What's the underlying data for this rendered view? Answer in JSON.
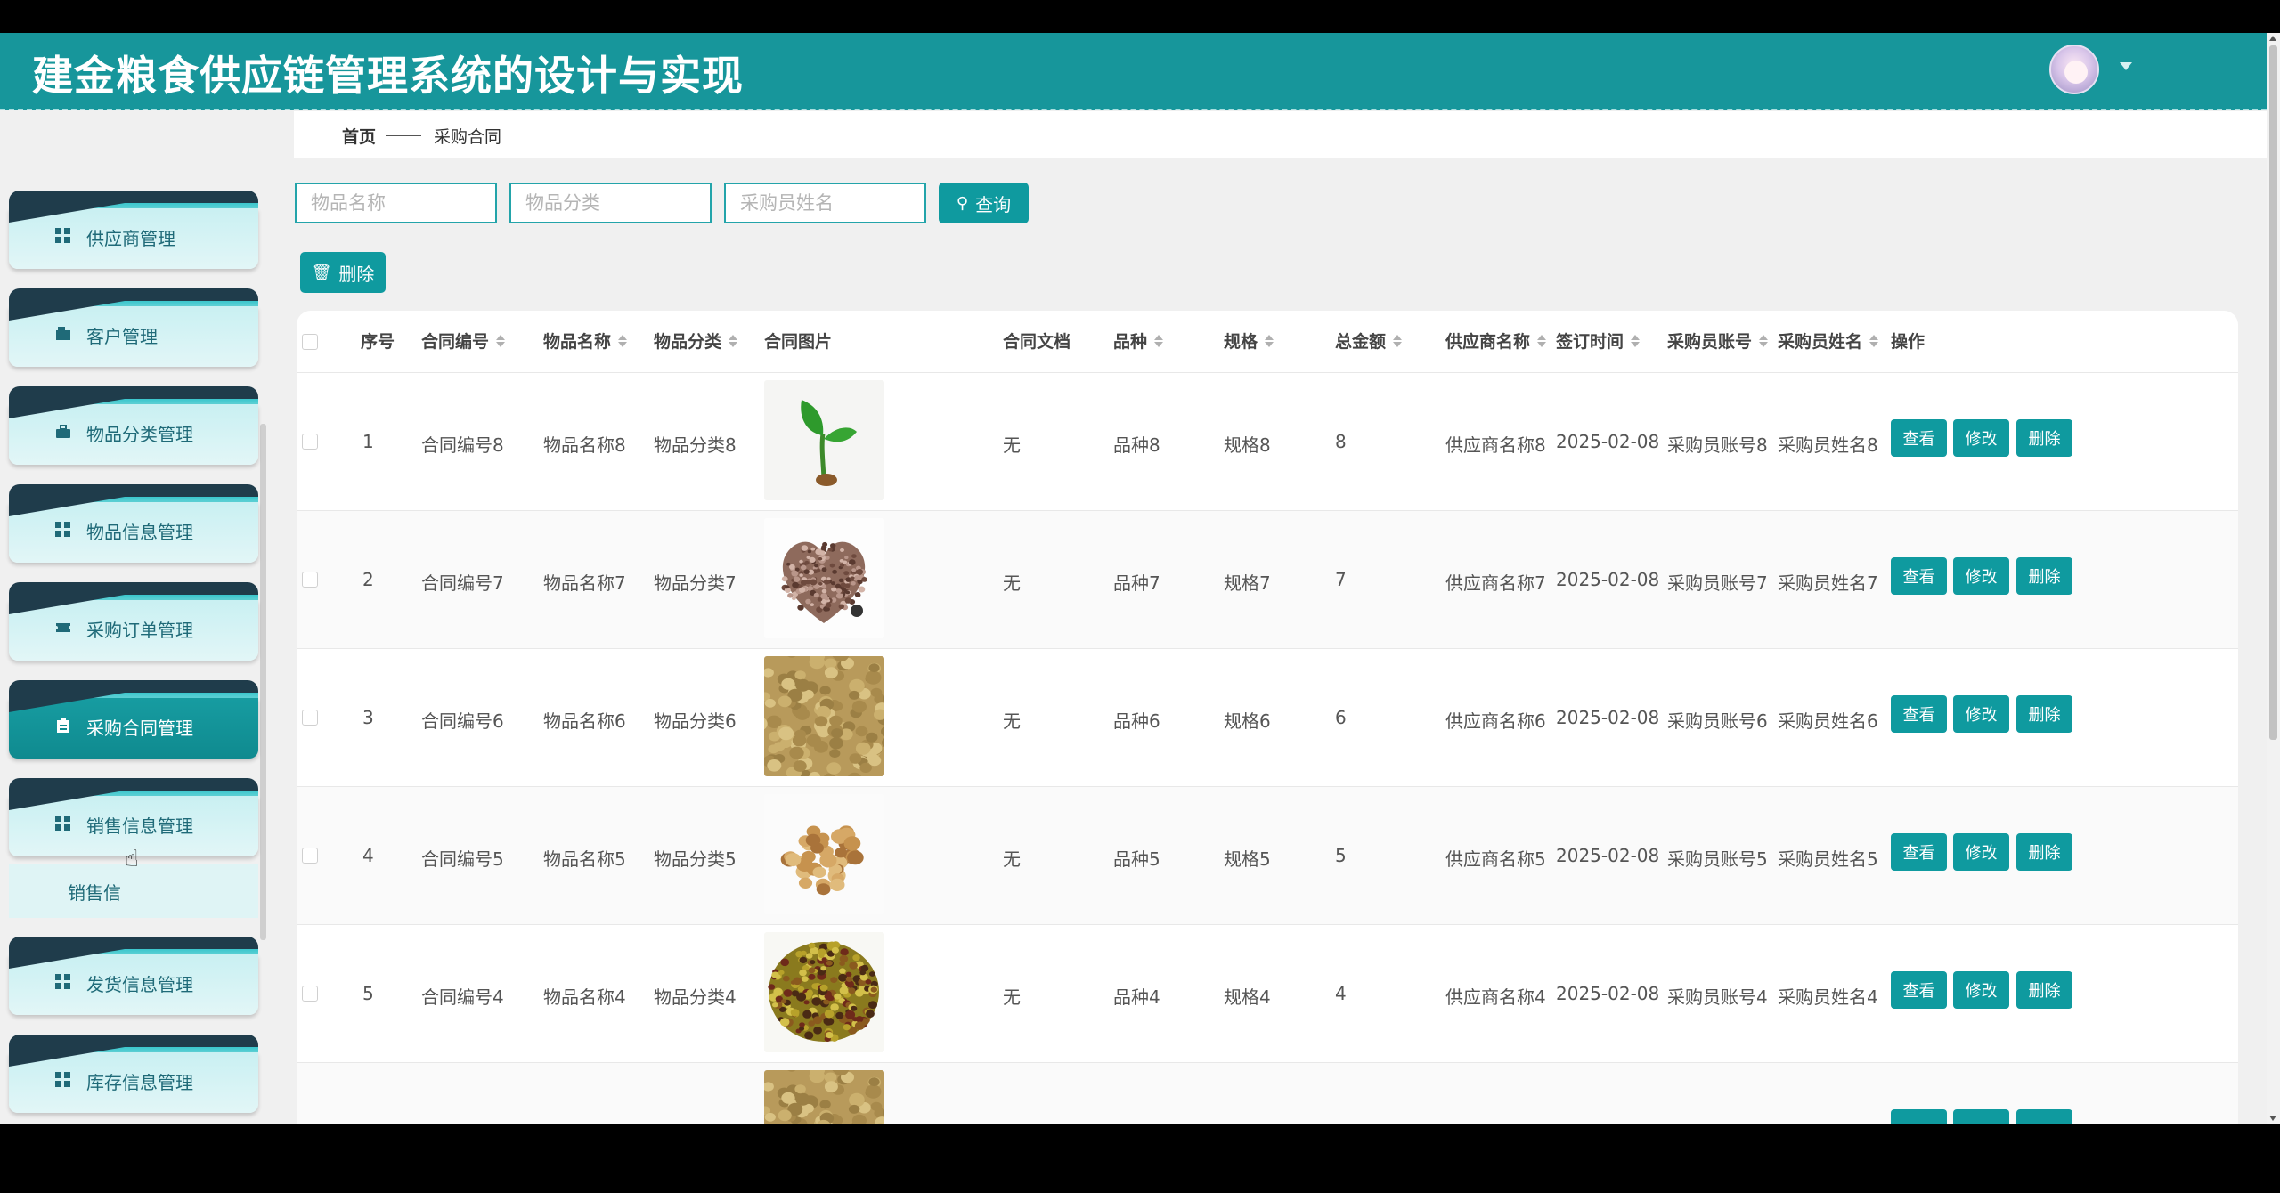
{
  "app": {
    "title": "建金粮食供应链管理系统的设计与实现"
  },
  "sidebar": {
    "items": [
      {
        "label": "供应商管理",
        "icon": "grid-icon",
        "active": false
      },
      {
        "label": "客户管理",
        "icon": "user-card-icon",
        "active": false
      },
      {
        "label": "物品分类管理",
        "icon": "briefcase-icon",
        "active": false
      },
      {
        "label": "物品信息管理",
        "icon": "grid-icon",
        "active": false
      },
      {
        "label": "采购订单管理",
        "icon": "ticket-icon",
        "active": false
      },
      {
        "label": "采购合同管理",
        "icon": "clipboard-icon",
        "active": true
      },
      {
        "label": "销售信息管理",
        "icon": "grid-icon",
        "active": false
      },
      {
        "label": "发货信息管理",
        "icon": "grid-icon",
        "active": false
      },
      {
        "label": "库存信息管理",
        "icon": "grid-icon",
        "active": false
      }
    ],
    "sub_item": "销售信"
  },
  "breadcrumb": {
    "home": "首页",
    "current": "采购合同"
  },
  "search": {
    "item_name_placeholder": "物品名称",
    "item_category_placeholder": "物品分类",
    "buyer_name_placeholder": "采购员姓名",
    "button": "查询"
  },
  "toolbar": {
    "delete": "删除"
  },
  "table": {
    "headers": {
      "index": "序号",
      "contract_no": "合同编号",
      "item_name": "物品名称",
      "item_category": "物品分类",
      "contract_image": "合同图片",
      "contract_doc": "合同文档",
      "variety": "品种",
      "spec": "规格",
      "total": "总金额",
      "supplier": "供应商名称",
      "sign_date": "签订时间",
      "buyer_account": "采购员账号",
      "buyer_name": "采购员姓名",
      "actions": "操作"
    },
    "row_actions": {
      "view": "查看",
      "edit": "修改",
      "delete": "删除"
    },
    "rows": [
      {
        "index": "1",
        "contract_no": "合同编号8",
        "item_name": "物品名称8",
        "item_category": "物品分类8",
        "image": "seedling",
        "contract_doc": "无",
        "variety": "品种8",
        "spec": "规格8",
        "total": "8",
        "supplier": "供应商名称8",
        "sign_date": "2025-02-08",
        "buyer_account": "采购员账号8",
        "buyer_name": "采购员姓名8"
      },
      {
        "index": "2",
        "contract_no": "合同编号7",
        "item_name": "物品名称7",
        "item_category": "物品分类7",
        "image": "heart-grains",
        "contract_doc": "无",
        "variety": "品种7",
        "spec": "规格7",
        "total": "7",
        "supplier": "供应商名称7",
        "sign_date": "2025-02-08",
        "buyer_account": "采购员账号7",
        "buyer_name": "采购员姓名7"
      },
      {
        "index": "3",
        "contract_no": "合同编号6",
        "item_name": "物品名称6",
        "item_category": "物品分类6",
        "image": "soybeans",
        "contract_doc": "无",
        "variety": "品种6",
        "spec": "规格6",
        "total": "6",
        "supplier": "供应商名称6",
        "sign_date": "2025-02-08",
        "buyer_account": "采购员账号6",
        "buyer_name": "采购员姓名6"
      },
      {
        "index": "4",
        "contract_no": "合同编号5",
        "item_name": "物品名称5",
        "item_category": "物品分类5",
        "image": "chickpeas",
        "contract_doc": "无",
        "variety": "品种5",
        "spec": "规格5",
        "total": "5",
        "supplier": "供应商名称5",
        "sign_date": "2025-02-08",
        "buyer_account": "采购员账号5",
        "buyer_name": "采购员姓名5"
      },
      {
        "index": "5",
        "contract_no": "合同编号4",
        "item_name": "物品名称4",
        "item_category": "物品分类4",
        "image": "mixed-grains",
        "contract_doc": "无",
        "variety": "品种4",
        "spec": "规格4",
        "total": "4",
        "supplier": "供应商名称4",
        "sign_date": "2025-02-08",
        "buyer_account": "采购员账号4",
        "buyer_name": "采购员姓名4"
      }
    ]
  },
  "colors": {
    "primary": "#0f9a9f",
    "header": "#17969b",
    "sidebar_dark": "#1f3c4b"
  }
}
